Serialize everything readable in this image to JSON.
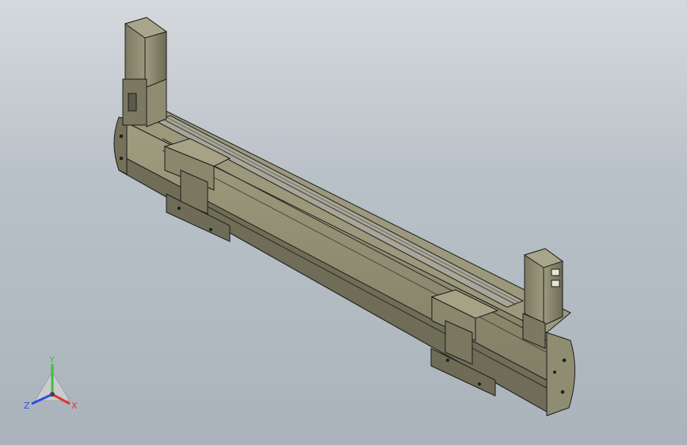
{
  "viewport": {
    "background_top": "#d4d9dd",
    "background_bottom": "#aab3bb"
  },
  "model": {
    "body_color": "#8c8a6e",
    "body_dark": "#5f5e4a",
    "body_light": "#a9a68a",
    "edge_color": "#1c1c1c",
    "rail_color": "#9a9a8f"
  },
  "triad": {
    "x_label": "X",
    "y_label": "Y",
    "z_label": "Z",
    "x_color": "#e0362f",
    "y_color": "#3fbf3f",
    "z_color": "#2f4fe0"
  }
}
